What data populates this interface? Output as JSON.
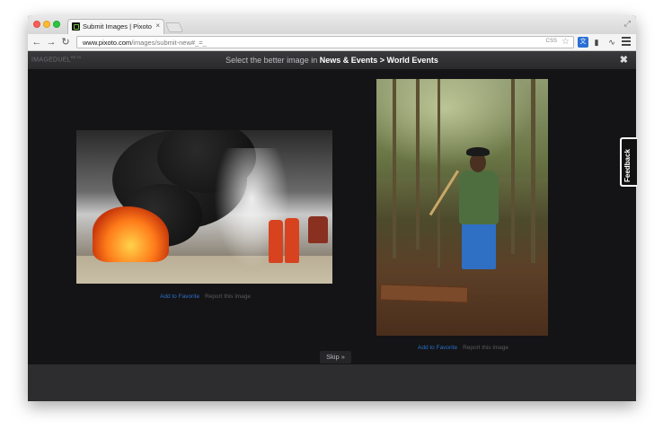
{
  "browser": {
    "tab_title": "Submit Images | Pixoto",
    "tab_close": "×",
    "url_host": "www.pixoto.com",
    "url_path": "/images/submit-new#_=_",
    "omnibox_badge": "CSS",
    "omnibox_star": "☆"
  },
  "header": {
    "logo_text": "IMAGEDUEL",
    "logo_mark": "BETA",
    "prompt_prefix": "Select the better image in ",
    "category": "News & Events",
    "separator": " > ",
    "subcategory": "World Events",
    "close_label": "✖"
  },
  "images": [
    {
      "favorite_label": "Add to Favorite",
      "report_label": "Report this image"
    },
    {
      "favorite_label": "Add to Favorite",
      "report_label": "Report this image"
    }
  ],
  "skip_label": "Skip »",
  "feedback_label": "Feedback",
  "colors": {
    "link": "#2b6fc8",
    "page_bg": "#141416"
  },
  "icons": [
    "back-icon",
    "forward-icon",
    "reload-icon",
    "star-icon",
    "menu-icon",
    "close-icon"
  ]
}
